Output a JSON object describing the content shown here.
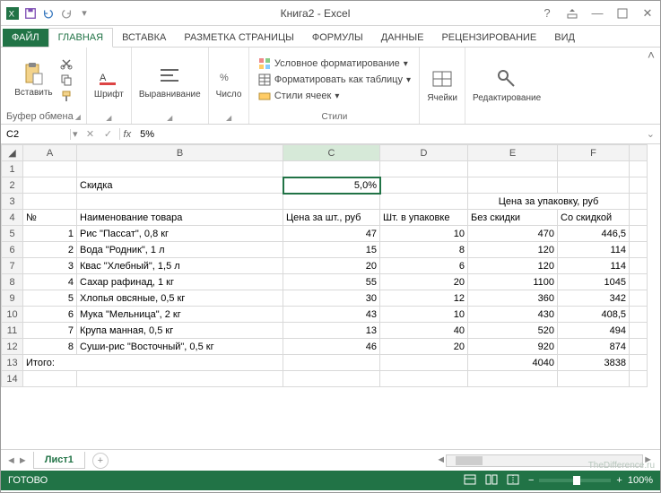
{
  "title": "Книга2 - Excel",
  "tabs": {
    "file": "ФАЙЛ",
    "home": "ГЛАВНАЯ",
    "insert": "ВСТАВКА",
    "layout": "РАЗМЕТКА СТРАНИЦЫ",
    "formulas": "ФОРМУЛЫ",
    "data": "ДАННЫЕ",
    "review": "РЕЦЕНЗИРОВАНИЕ",
    "view": "ВИД"
  },
  "ribbon": {
    "clipboard": {
      "paste": "Вставить",
      "label": "Буфер обмена"
    },
    "font": {
      "btn": "Шрифт"
    },
    "align": {
      "btn": "Выравнивание"
    },
    "number": {
      "btn": "Число"
    },
    "styles": {
      "cond": "Условное форматирование",
      "table": "Форматировать как таблицу",
      "cells": "Стили ячеек",
      "label": "Стили"
    },
    "cellsgrp": {
      "btn": "Ячейки"
    },
    "edit": {
      "btn": "Редактирование"
    }
  },
  "namebox": "C2",
  "formula": "5%",
  "cols": [
    "A",
    "B",
    "C",
    "D",
    "E",
    "F"
  ],
  "sheet": {
    "r2": {
      "b": "Скидка",
      "c": "5,0%"
    },
    "r3": {
      "e": "Цена за упаковку, руб"
    },
    "r4": {
      "a": "№",
      "b": "Наименование товара",
      "c": "Цена за шт., руб",
      "d": "Шт. в упаковке",
      "e": "Без скидки",
      "f": "Со скидкой"
    },
    "rows": [
      {
        "n": "1",
        "name": "Рис \"Пассат\", 0,8 кг",
        "price": "47",
        "qty": "10",
        "sum": "470",
        "disc": "446,5"
      },
      {
        "n": "2",
        "name": "Вода \"Родник\", 1 л",
        "price": "15",
        "qty": "8",
        "sum": "120",
        "disc": "114"
      },
      {
        "n": "3",
        "name": "Квас \"Хлебный\", 1,5 л",
        "price": "20",
        "qty": "6",
        "sum": "120",
        "disc": "114"
      },
      {
        "n": "4",
        "name": "Сахар рафинад, 1 кг",
        "price": "55",
        "qty": "20",
        "sum": "1100",
        "disc": "1045"
      },
      {
        "n": "5",
        "name": "Хлопья овсяные, 0,5 кг",
        "price": "30",
        "qty": "12",
        "sum": "360",
        "disc": "342"
      },
      {
        "n": "6",
        "name": "Мука \"Мельница\", 2 кг",
        "price": "43",
        "qty": "10",
        "sum": "430",
        "disc": "408,5"
      },
      {
        "n": "7",
        "name": "Крупа манная, 0,5 кг",
        "price": "13",
        "qty": "40",
        "sum": "520",
        "disc": "494"
      },
      {
        "n": "8",
        "name": "Суши-рис \"Восточный\", 0,5 кг",
        "price": "46",
        "qty": "20",
        "sum": "920",
        "disc": "874"
      }
    ],
    "total": {
      "a": "Итого:",
      "e": "4040",
      "f": "3838"
    }
  },
  "sheettab": "Лист1",
  "status": "ГОТОВО",
  "zoom": "100%",
  "watermark": "TheDifference.ru"
}
